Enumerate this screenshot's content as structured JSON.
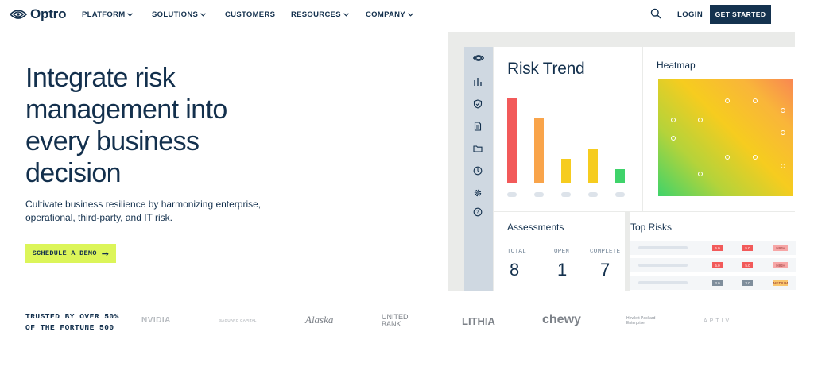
{
  "nav": {
    "logo": "Optro",
    "items": [
      {
        "label": "PLATFORM",
        "dropdown": true
      },
      {
        "label": "SOLUTIONS",
        "dropdown": true
      },
      {
        "label": "CUSTOMERS",
        "dropdown": false
      },
      {
        "label": "RESOURCES",
        "dropdown": true
      },
      {
        "label": "COMPANY",
        "dropdown": true
      }
    ],
    "login": "LOGIN",
    "cta": "GET STARTED"
  },
  "hero": {
    "title": "Integrate risk management into every business decision",
    "subtitle": "Cultivate business resilience by harmonizing enterprise, operational, third-party, and IT risk.",
    "cta": "SCHEDULE A DEMO"
  },
  "dashboard": {
    "sidebar_icons": [
      "eye-logo-icon",
      "bar-chart-icon",
      "shield-icon",
      "document-icon",
      "folder-icon",
      "clock-icon",
      "gear-icon",
      "help-icon"
    ],
    "risk_trend": {
      "title": "Risk Trend",
      "bars": [
        {
          "value": 1.0,
          "color": "#f25a5a"
        },
        {
          "value": 0.76,
          "color": "#f9a44a"
        },
        {
          "value": 0.28,
          "color": "#f6cc1f"
        },
        {
          "value": 0.39,
          "color": "#f6cc1f"
        },
        {
          "value": 0.16,
          "color": "#3fd36a"
        }
      ]
    },
    "heatmap": {
      "title": "Heatmap"
    },
    "assessments": {
      "title": "Assessments",
      "stats": [
        {
          "label": "TOTAL",
          "value": "8"
        },
        {
          "label": "OPEN",
          "value": "1"
        },
        {
          "label": "COMPLETE",
          "value": "7"
        }
      ]
    },
    "top_risks": {
      "title": "Top Risks",
      "rows": [
        {
          "b1": "5.0",
          "b2": "5.0",
          "level": "HIGH",
          "c1": "#f25a5a",
          "c2": "#f25a5a",
          "c3": "#f7a6a6"
        },
        {
          "b1": "5.0",
          "b2": "5.0",
          "level": "HIGH",
          "c1": "#f25a5a",
          "c2": "#f25a5a",
          "c3": "#f7a6a6"
        },
        {
          "b1": "3.0",
          "b2": "3.0",
          "level": "MEDIUM",
          "c1": "#7f8e9c",
          "c2": "#7f8e9c",
          "c3": "#f9c66e"
        }
      ]
    }
  },
  "trusted": {
    "text": "TRUSTED BY OVER 50% OF THE FORTUNE 500",
    "brands": [
      "NVIDIA",
      "SAGUARO CAPITAL",
      "Alaska",
      "UNITED BANK",
      "LITHIA",
      "chewy",
      "Hewlett Packard Enterprise",
      "APTIV"
    ]
  }
}
